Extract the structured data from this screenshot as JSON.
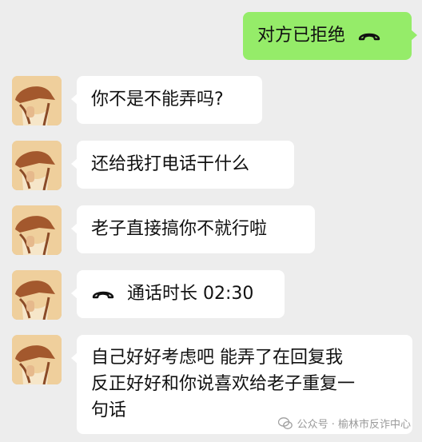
{
  "messages": {
    "m0": {
      "text": "对方已拒绝"
    },
    "m1": {
      "text": "你不是不能弄吗?"
    },
    "m2": {
      "text": "还给我打电话干什么"
    },
    "m3": {
      "text": "老子直接搞你不就行啦"
    },
    "m4": {
      "text": "通话时长 02:30"
    },
    "m5": {
      "lines": [
        "自己好好考虑吧 能弄了在回复我",
        "反正好好和你说喜欢给老子重复一",
        "句话"
      ]
    }
  },
  "watermark": {
    "text": "公众号 · 榆林市反诈中心"
  },
  "colors": {
    "background": "#ededed",
    "outgoing_bubble": "#95ec69",
    "incoming_bubble": "#ffffff"
  },
  "icons": {
    "call": "phone-hangup-icon",
    "watermark": "wechat-icon"
  }
}
